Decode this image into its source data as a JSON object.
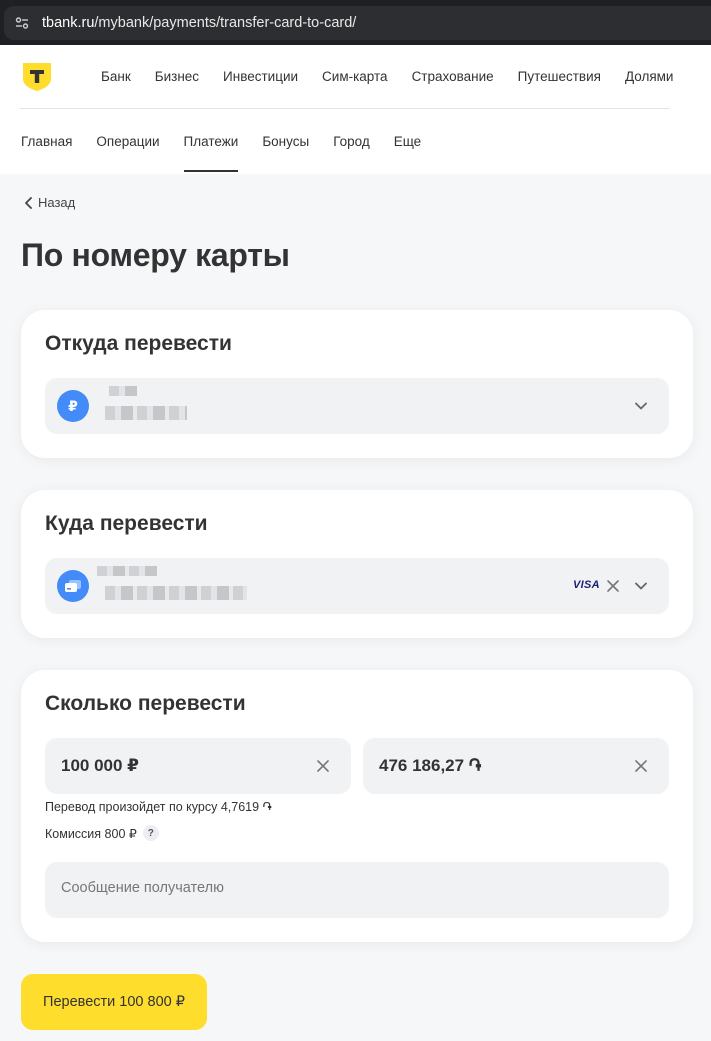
{
  "browser": {
    "url_domain": "tbank.ru",
    "url_path": "/mybank/payments/transfer-card-to-card/"
  },
  "header": {
    "top_nav": [
      "Банк",
      "Бизнес",
      "Инвестиции",
      "Сим-карта",
      "Страхование",
      "Путешествия",
      "Долями"
    ],
    "sub_nav": [
      {
        "label": "Главная",
        "active": false
      },
      {
        "label": "Операции",
        "active": false
      },
      {
        "label": "Платежи",
        "active": true
      },
      {
        "label": "Бонусы",
        "active": false
      },
      {
        "label": "Город",
        "active": false
      },
      {
        "label": "Еще",
        "active": false
      }
    ]
  },
  "page": {
    "back_label": "Назад",
    "title": "По номеру карты"
  },
  "from_card": {
    "title": "Откуда перевести",
    "account_icon_symbol": "₽"
  },
  "to_card": {
    "title": "Куда перевести",
    "card_brand": "VISA"
  },
  "amount_card": {
    "title": "Сколько перевести",
    "amount_rub": "100 000 ₽",
    "amount_converted": "476 186,27 ֏",
    "rate_text": "Перевод произойдет по курсу 4,7619 ֏",
    "fee_text": "Комиссия 800 ₽",
    "fee_help": "?",
    "message_placeholder": "Сообщение получателю"
  },
  "submit": {
    "label": "Перевести 100 800 ₽"
  },
  "colors": {
    "accent_yellow": "#ffdd2d",
    "icon_blue": "#428bf9",
    "field_bg": "#f1f2f4",
    "page_bg": "#f6f7f8"
  }
}
